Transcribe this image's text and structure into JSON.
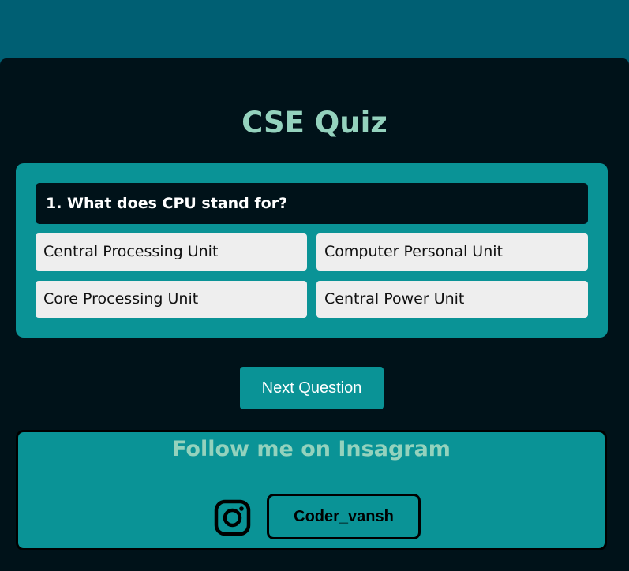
{
  "quiz": {
    "title": "CSE Quiz",
    "question": "1. What does CPU stand for?",
    "answers": [
      "Central Processing Unit",
      "Computer Personal Unit",
      "Core Processing Unit",
      "Central Power Unit"
    ],
    "next_label": "Next Question"
  },
  "follow": {
    "title": "Follow me on Insagram",
    "icon": "instagram-icon",
    "handle": "Coder_vansh"
  },
  "colors": {
    "page_bg": "#005f73",
    "card_bg": "#001219",
    "accent": "#0a9396",
    "title": "#94d2bd",
    "answer_bg": "#eeeeee"
  }
}
